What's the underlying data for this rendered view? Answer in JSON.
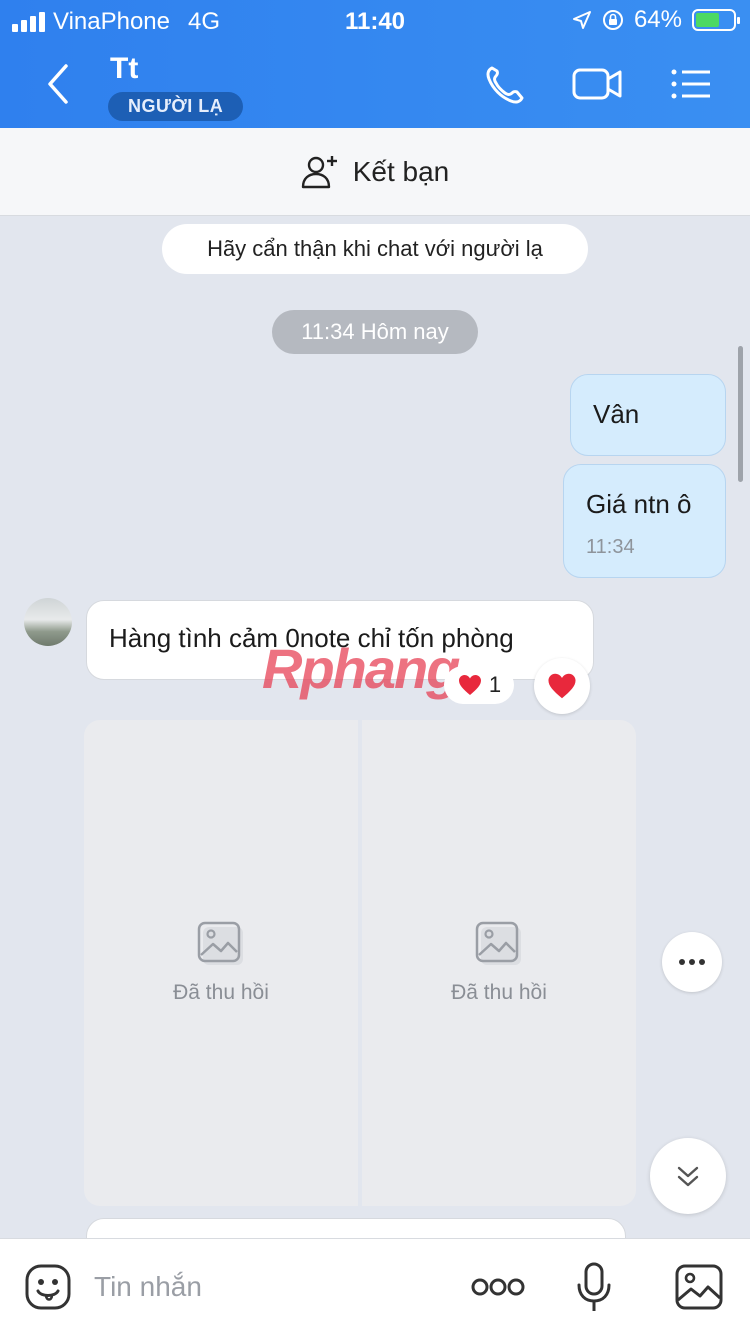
{
  "status": {
    "carrier": "VinaPhone",
    "network": "4G",
    "time": "11:40",
    "battery": "64%",
    "battery_level": 0.64
  },
  "header": {
    "name": "Tt",
    "badge": "NGƯỜI LẠ"
  },
  "add_friend": {
    "label": "Kết bạn"
  },
  "chat": {
    "notice": "Hãy cẩn thận khi chat với người lạ",
    "time_divider": "11:34 Hôm nay",
    "messages": [
      {
        "from": "me",
        "text": "Vân"
      },
      {
        "from": "me",
        "text": "Giá ntn ô",
        "time": "11:34"
      },
      {
        "from": "other",
        "text": "Hàng tình cảm 0note chỉ tốn phòng"
      }
    ],
    "reaction_count": "1",
    "recalled": [
      "Đã thu hồi",
      "Đã thu hồi"
    ],
    "watermark": {
      "part1": "Rphang",
      "part2": ""
    }
  },
  "input": {
    "placeholder": "Tin nhắn"
  },
  "colors": {
    "accent": "#2f80ee",
    "bubble_me": "#d5ecfd",
    "heart": "#e8283c"
  }
}
